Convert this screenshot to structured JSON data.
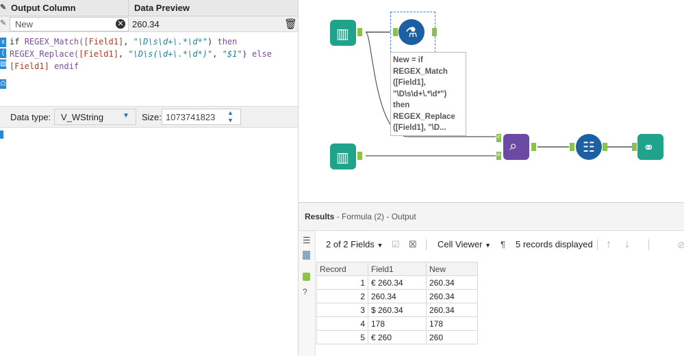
{
  "left_panel": {
    "headers": {
      "output_column": "Output Column",
      "data_preview": "Data Preview"
    },
    "row": {
      "field_name": "New",
      "preview_value": "260.34"
    },
    "expression": {
      "line1_a": "if ",
      "line1_fn": "REGEX_Match(",
      "line1_fld": "[Field1]",
      "line1_sep": ", ",
      "line1_str": "\"\\D\\s\\d+\\.*\\d*\"",
      "line1_close": ") ",
      "line1_kw": "then",
      "line2_fn": "REGEX_Replace(",
      "line2_fld": "[Field1]",
      "line2_sep": ", ",
      "line2_str": "\"\\D\\s(\\d+\\.*\\d*)\"",
      "line2_sep2": ", ",
      "line2_str2": "\"$1\"",
      "line2_close": ") ",
      "line2_kw": "else",
      "line3_fld": "[Field1]",
      "line3_kw": " endif"
    },
    "datatype_label": "Data type:",
    "datatype_value": "V_WString",
    "size_label": "Size:",
    "size_value": "1073741823"
  },
  "canvas": {
    "annotation": [
      "New = if",
      "REGEX_Match",
      "([Field1],",
      "\"\\D\\s\\d+\\.*\\d*\")",
      "then",
      "REGEX_Replace",
      "([Field1], \"\\D..."
    ],
    "colors": {
      "teal": "#1fa38a",
      "blue": "#1d5fa3",
      "purple": "#6b4aa3",
      "anchor": "#8bc34a"
    },
    "join_labels": {
      "f": "F",
      "r": "R"
    }
  },
  "results": {
    "title_bold": "Results",
    "title_rest": " - Formula (2) - Output",
    "fields_label": "2 of 2 Fields",
    "cell_viewer_label": "Cell Viewer",
    "records_label": "5 records displayed",
    "columns": [
      "Record",
      "Field1",
      "New"
    ],
    "rows": [
      {
        "record": "1",
        "field1": "€ 260.34",
        "new": "260.34"
      },
      {
        "record": "2",
        "field1": "260.34",
        "new": "260.34"
      },
      {
        "record": "3",
        "field1": "$ 260.34",
        "new": "260.34"
      },
      {
        "record": "4",
        "field1": "178",
        "new": "178"
      },
      {
        "record": "5",
        "field1": "€ 260",
        "new": "260"
      }
    ]
  }
}
